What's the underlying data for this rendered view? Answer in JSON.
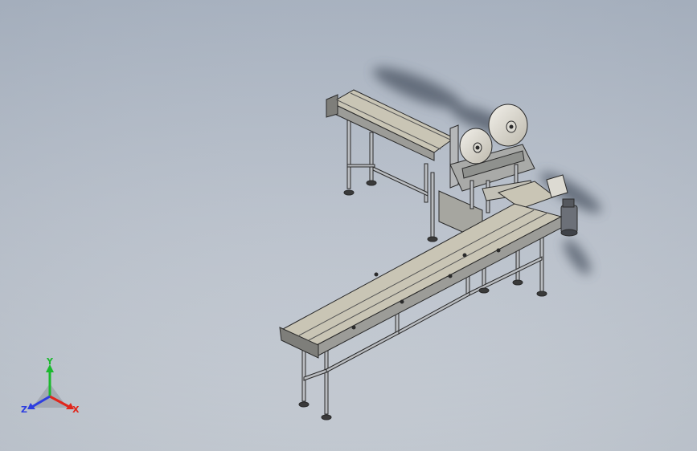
{
  "viewport": {
    "model": "conveyor-assembly",
    "colors": {
      "belt": "#c9c5b5",
      "frame": "#9c9c98",
      "edge": "#2a2a2a",
      "shadow": "#6f7680",
      "leg": "#b9bcc0",
      "foot": "#3a3a3a"
    }
  },
  "triad": {
    "x_label": "X",
    "y_label": "Y",
    "z_label": "Z",
    "colors": {
      "x": "#e0261b",
      "y": "#1bb92e",
      "z": "#2d3ee0"
    }
  }
}
